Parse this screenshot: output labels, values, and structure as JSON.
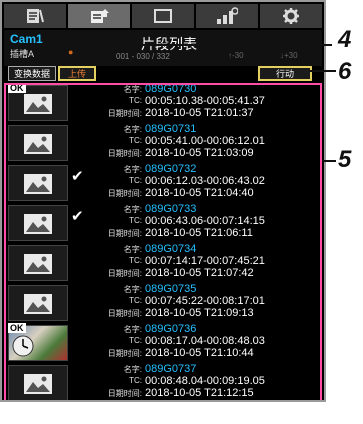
{
  "tabs": [
    {
      "name": "clip-notes"
    },
    {
      "name": "clip-list"
    },
    {
      "name": "display"
    },
    {
      "name": "camera"
    },
    {
      "name": "settings"
    }
  ],
  "header": {
    "cam": "Cam1",
    "slot": "插槽A",
    "indicator": "●",
    "title": "片段列表",
    "count": "001 - 030 / 332",
    "remain1": "↑-30",
    "remain2": "↓+30"
  },
  "buttons": {
    "switch": "变换数据",
    "upload": "上传",
    "action": "行动"
  },
  "labels": {
    "name": "名字:",
    "tc": "TC:",
    "datetime": "日期时间:"
  },
  "clips": [
    {
      "name": "089G0730",
      "tc": "00:05:10.38-00:05:41.37",
      "datetime": "2018-10-05 T21:01:37",
      "ok": "OK",
      "checked": false,
      "thumb": "placeholder"
    },
    {
      "name": "089G0731",
      "tc": "00:05:41.00-00:06:12.01",
      "datetime": "2018-10-05 T21:03:09",
      "ok": "",
      "checked": false,
      "thumb": "placeholder"
    },
    {
      "name": "089G0732",
      "tc": "00:06:12.03-00:06:43.02",
      "datetime": "2018-10-05 T21:04:40",
      "ok": "",
      "checked": true,
      "thumb": "placeholder"
    },
    {
      "name": "089G0733",
      "tc": "00:06:43.06-00:07:14:15",
      "datetime": "2018-10-05 T21:06:11",
      "ok": "",
      "checked": true,
      "thumb": "placeholder"
    },
    {
      "name": "089G0734",
      "tc": "00:07:14:17-00:07:45:21",
      "datetime": "2018-10-05 T21:07:42",
      "ok": "",
      "checked": false,
      "thumb": "placeholder"
    },
    {
      "name": "089G0735",
      "tc": "00:07:45:22-00:08:17:01",
      "datetime": "2018-10-05 T21:09:13",
      "ok": "",
      "checked": false,
      "thumb": "placeholder"
    },
    {
      "name": "089G0736",
      "tc": "00:08:17.04-00:08:48.03",
      "datetime": "2018-10-05 T21:10:44",
      "ok": "OK",
      "checked": false,
      "thumb": "photo"
    },
    {
      "name": "089G0737",
      "tc": "00:08:48.04-00:09:19.05",
      "datetime": "2018-10-05 T21:12:15",
      "ok": "",
      "checked": false,
      "thumb": "placeholder"
    }
  ],
  "callouts": {
    "c4": "4",
    "c5": "5",
    "c6": "6"
  },
  "colors": {
    "accent_blue": "#26c0ff",
    "highlight_frame": "#e2d060",
    "selection_border": "#ff4da6"
  }
}
